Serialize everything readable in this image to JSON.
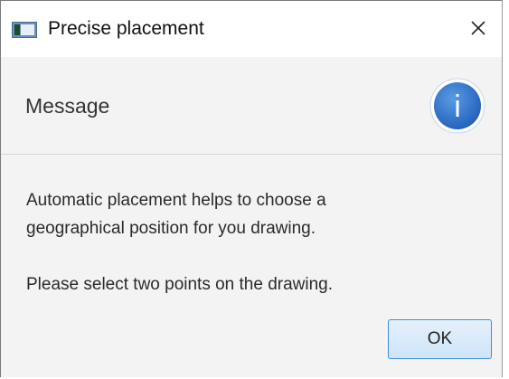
{
  "window": {
    "title": "Precise placement",
    "app_icon": "app-window-icon",
    "close_icon": "close-icon"
  },
  "header": {
    "text": "Message",
    "icon": "info-icon",
    "icon_glyph": "i",
    "icon_color": "#2a6fc9"
  },
  "message": {
    "line1": "Automatic placement helps to choose a",
    "line2": "geographical position for you drawing.",
    "line3": "Please select two points on the drawing."
  },
  "buttons": {
    "ok_label": "OK",
    "ok_border_color": "#3c8fd6"
  }
}
